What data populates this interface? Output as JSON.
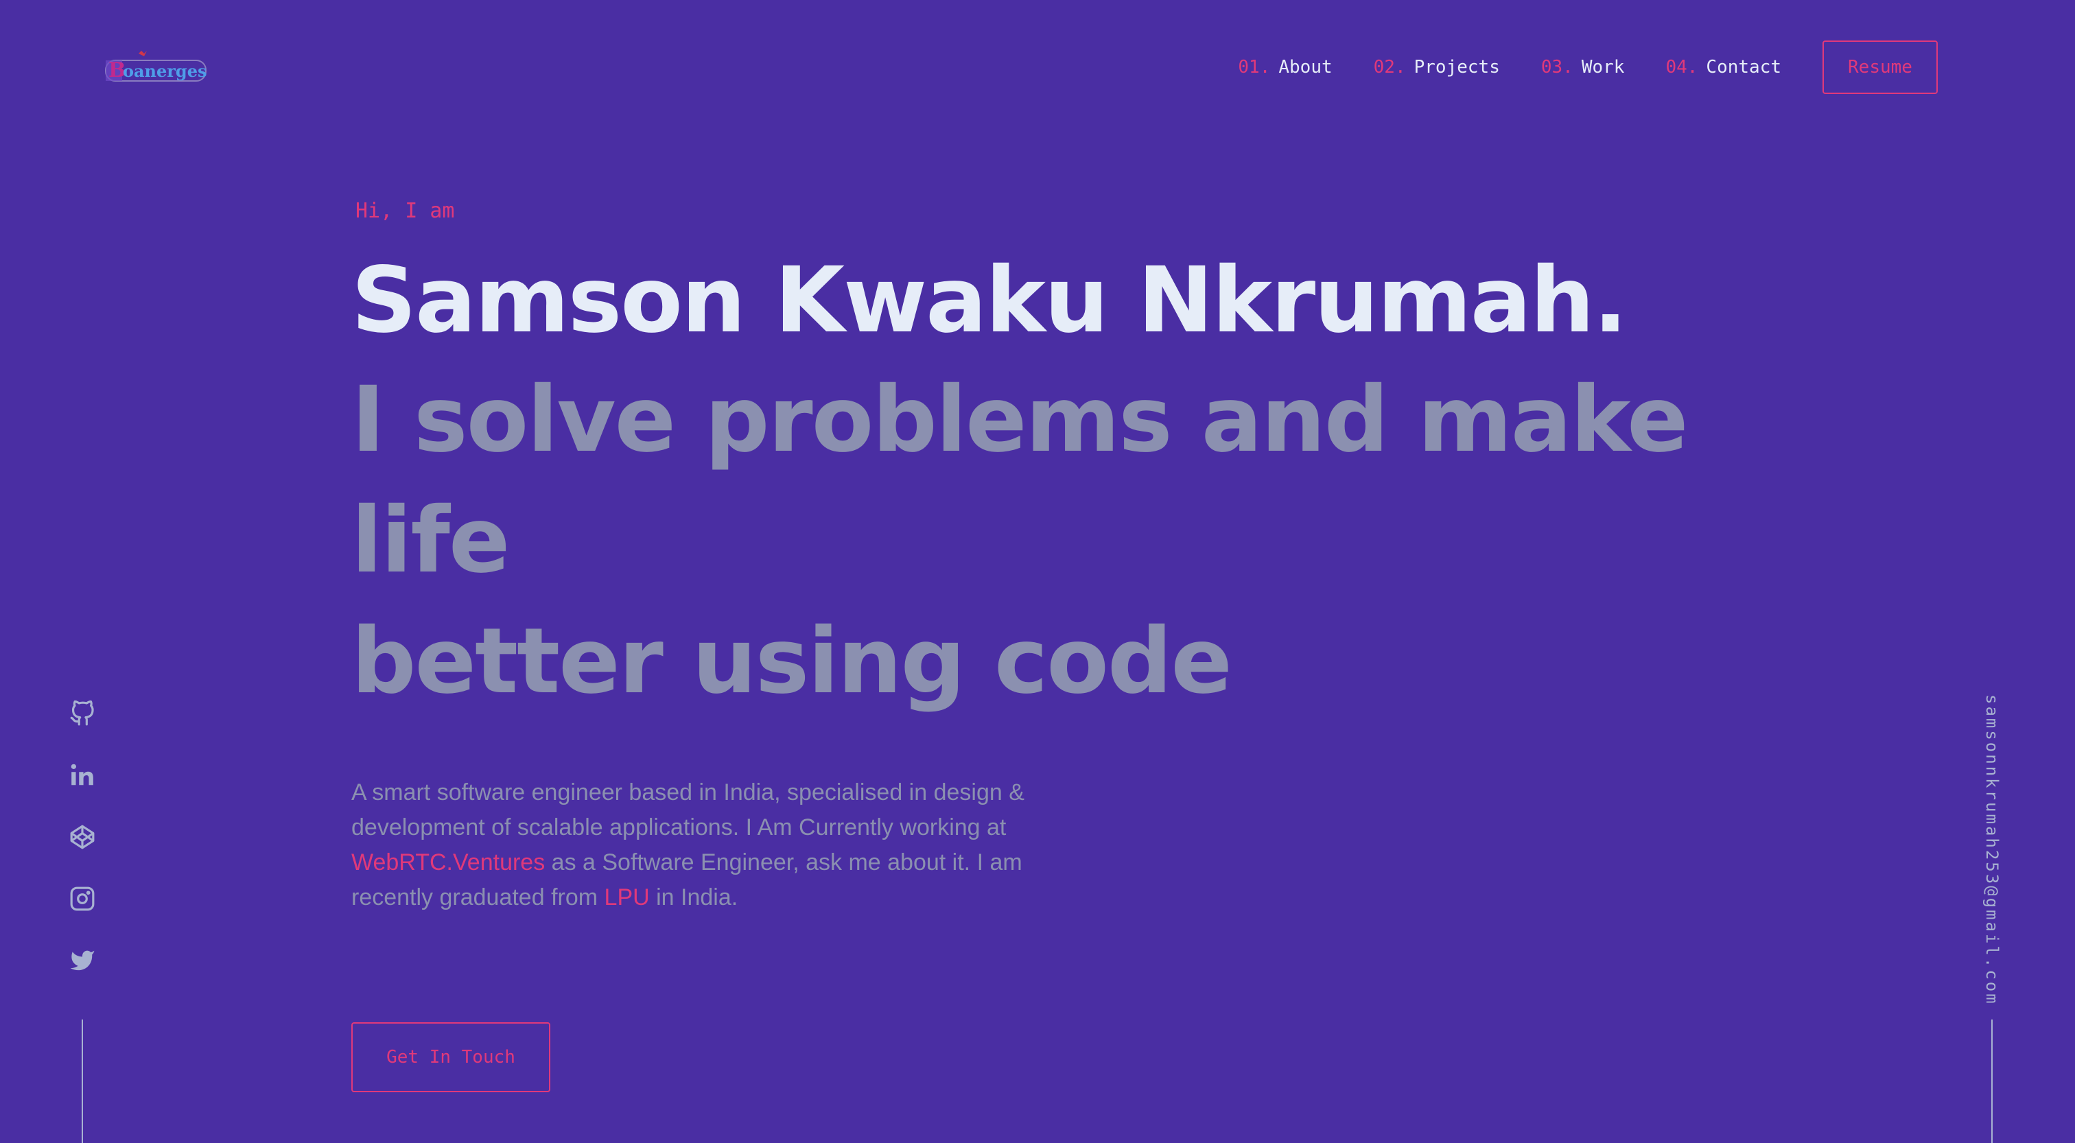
{
  "brand": {
    "logo_text": "Boanerges",
    "colors": {
      "background": "#4a2ea3",
      "accent": "#e0397a",
      "heading": "#e6edf8",
      "muted": "#8b90b0"
    }
  },
  "nav": {
    "items": [
      {
        "num": "01.",
        "label": "About"
      },
      {
        "num": "02.",
        "label": "Projects"
      },
      {
        "num": "03.",
        "label": "Work"
      },
      {
        "num": "04.",
        "label": "Contact"
      }
    ],
    "resume_label": "Resume"
  },
  "hero": {
    "greeting": "Hi, I am",
    "name": "Samson Kwaku Nkrumah.",
    "tagline_line1": "I solve problems and make life",
    "tagline_line2": "better using code",
    "bio": {
      "part1": "A smart software engineer based in India, specialised in design & development of scalable applications. I Am Currently working at ",
      "company": "WebRTC.Ventures",
      "part2": " as a Software Engineer, ask me about it. I am recently graduated from ",
      "school": "LPU",
      "part3": " in India."
    },
    "cta_label": "Get In Touch"
  },
  "social": {
    "icons": [
      "github-icon",
      "linkedin-icon",
      "codepen-icon",
      "instagram-icon",
      "twitter-icon"
    ]
  },
  "email": "samsonnkrumah253@gmail.com"
}
